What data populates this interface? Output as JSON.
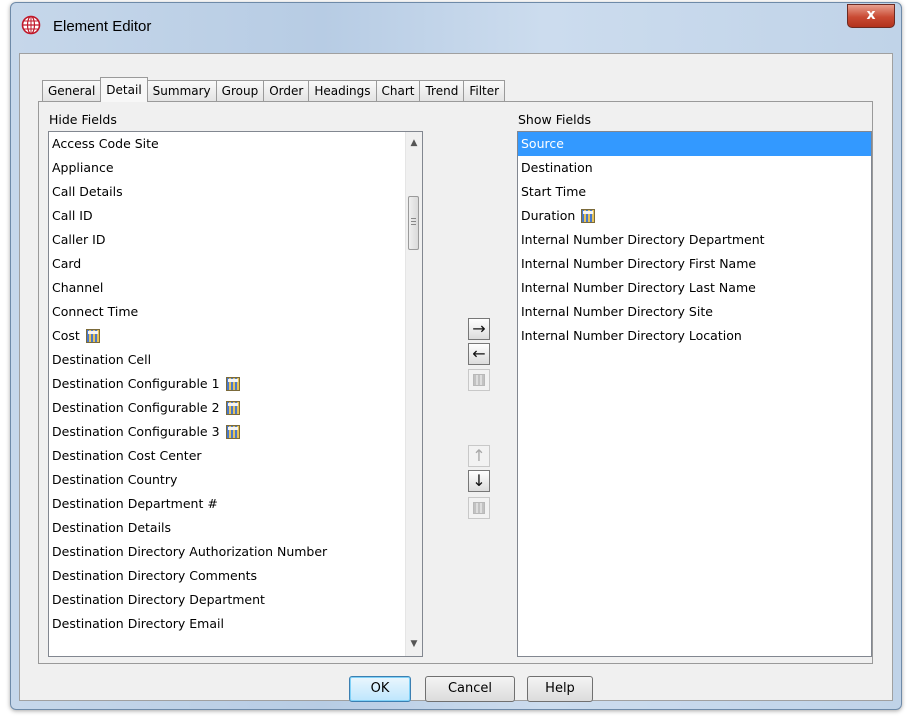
{
  "window": {
    "title": "Element Editor",
    "close_label": "x"
  },
  "tabs": [
    {
      "label": "General"
    },
    {
      "label": "Detail"
    },
    {
      "label": "Summary"
    },
    {
      "label": "Group"
    },
    {
      "label": "Order"
    },
    {
      "label": "Headings"
    },
    {
      "label": "Chart"
    },
    {
      "label": "Trend"
    },
    {
      "label": "Filter"
    }
  ],
  "active_tab": "Detail",
  "hide_fields": {
    "header": "Hide Fields",
    "items": [
      {
        "label": "Access Code Site",
        "icon": false
      },
      {
        "label": "Appliance",
        "icon": false
      },
      {
        "label": "Call Details",
        "icon": false
      },
      {
        "label": "Call ID",
        "icon": false
      },
      {
        "label": "Caller ID",
        "icon": false
      },
      {
        "label": "Card",
        "icon": false
      },
      {
        "label": "Channel",
        "icon": false
      },
      {
        "label": "Connect Time",
        "icon": false
      },
      {
        "label": "Cost",
        "icon": true
      },
      {
        "label": "Destination Cell",
        "icon": false
      },
      {
        "label": "Destination Configurable 1",
        "icon": true
      },
      {
        "label": "Destination Configurable 2",
        "icon": true
      },
      {
        "label": "Destination Configurable 3",
        "icon": true
      },
      {
        "label": "Destination Cost Center",
        "icon": false
      },
      {
        "label": "Destination Country",
        "icon": false
      },
      {
        "label": "Destination Department #",
        "icon": false
      },
      {
        "label": "Destination Details",
        "icon": false
      },
      {
        "label": "Destination Directory Authorization Number",
        "icon": false
      },
      {
        "label": "Destination Directory Comments",
        "icon": false
      },
      {
        "label": "Destination Directory Department",
        "icon": false
      },
      {
        "label": "Destination Directory Email",
        "icon": false
      }
    ]
  },
  "show_fields": {
    "header": "Show Fields",
    "selected": "Source",
    "items": [
      {
        "label": "Source",
        "icon": false
      },
      {
        "label": "Destination",
        "icon": false
      },
      {
        "label": "Start Time",
        "icon": false
      },
      {
        "label": "Duration",
        "icon": true
      },
      {
        "label": "Internal Number Directory Department",
        "icon": false
      },
      {
        "label": "Internal Number Directory First Name",
        "icon": false
      },
      {
        "label": "Internal Number Directory Last Name",
        "icon": false
      },
      {
        "label": "Internal Number Directory Site",
        "icon": false
      },
      {
        "label": "Internal Number Directory Location",
        "icon": false
      }
    ]
  },
  "mid_buttons": {
    "add_glyph": "→",
    "remove_glyph": "←",
    "up_glyph": "↑",
    "down_glyph": "↓"
  },
  "buttons": {
    "ok": "OK",
    "cancel": "Cancel",
    "help": "Help"
  },
  "colors": {
    "selection": "#3399ff",
    "close_button": "#c94a33",
    "title_bar": "#c6d7ea"
  }
}
